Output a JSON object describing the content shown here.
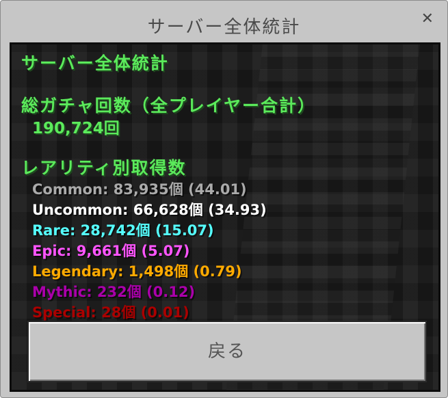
{
  "window": {
    "title": "サーバー全体統計",
    "close_glyph": "✕"
  },
  "panel": {
    "heading": "サーバー全体統計",
    "total_heading": "総ガチャ回数（全プレイヤー合計）",
    "total_value": "190,724回",
    "rarity_heading": "レアリティ別取得数",
    "rarities": [
      {
        "text": "Common: 83,935個 (44.01)",
        "color": "#aaaaaa"
      },
      {
        "text": "Uncommon: 66,628個 (34.93)",
        "color": "#ffffff"
      },
      {
        "text": "Rare: 28,742個 (15.07)",
        "color": "#55ffff"
      },
      {
        "text": "Epic: 9,661個 (5.07)",
        "color": "#ff55ff"
      },
      {
        "text": "Legendary: 1,498個 (0.79)",
        "color": "#ffaa00"
      },
      {
        "text": "Mythic: 232個 (0.12)",
        "color": "#aa00aa"
      },
      {
        "text": "Special: 28個 (0.01)",
        "color": "#aa0000"
      }
    ]
  },
  "buttons": {
    "back_label": "戻る"
  }
}
